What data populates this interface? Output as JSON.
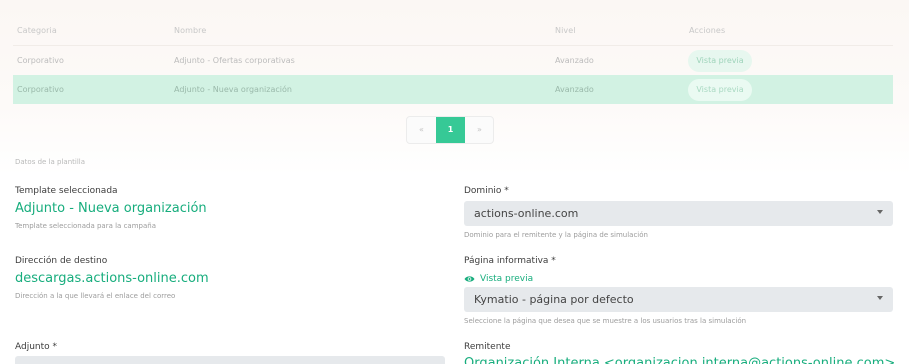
{
  "table": {
    "headers": [
      "Categoria",
      "Nombre",
      "Nivel",
      "Acciones"
    ],
    "rows": [
      {
        "category": "Corporativo",
        "name": "Adjunto - Ofertas corporativas",
        "level": "Avanzado",
        "action": "Vista previa",
        "selected": false
      },
      {
        "category": "Corporativo",
        "name": "Adjunto - Nueva organización",
        "level": "Avanzado",
        "action": "Vista previa",
        "selected": true
      }
    ]
  },
  "pagination": {
    "prev": "«",
    "current": "1",
    "next": "»"
  },
  "section_title": "Datos de la plantilla",
  "template": {
    "label": "Template seleccionada",
    "value": "Adjunto - Nueva organización",
    "helper": "Template seleccionada para la campaña"
  },
  "destination": {
    "label": "Dirección de destino",
    "value": "descargas.actions-online.com",
    "helper": "Dirección a la que llevará el enlace del correo"
  },
  "attachment": {
    "label": "Adjunto *"
  },
  "domain": {
    "label": "Dominio *",
    "value": "actions-online.com",
    "helper": "Dominio para el remitente y la página de simulación"
  },
  "info_page": {
    "label": "Página informativa *",
    "preview_link": "Vista previa",
    "value": "Kymatio - página por defecto",
    "helper": "Seleccione la página que desea que se muestre a los usuarios tras la simulación"
  },
  "sender": {
    "label": "Remitente",
    "value": "Organización Interna <organizacion.interna@actions-online.com>"
  },
  "colors": {
    "accent": "#17ad7d",
    "pager_active": "#36c996",
    "selected_row": "#d2f2e3"
  }
}
